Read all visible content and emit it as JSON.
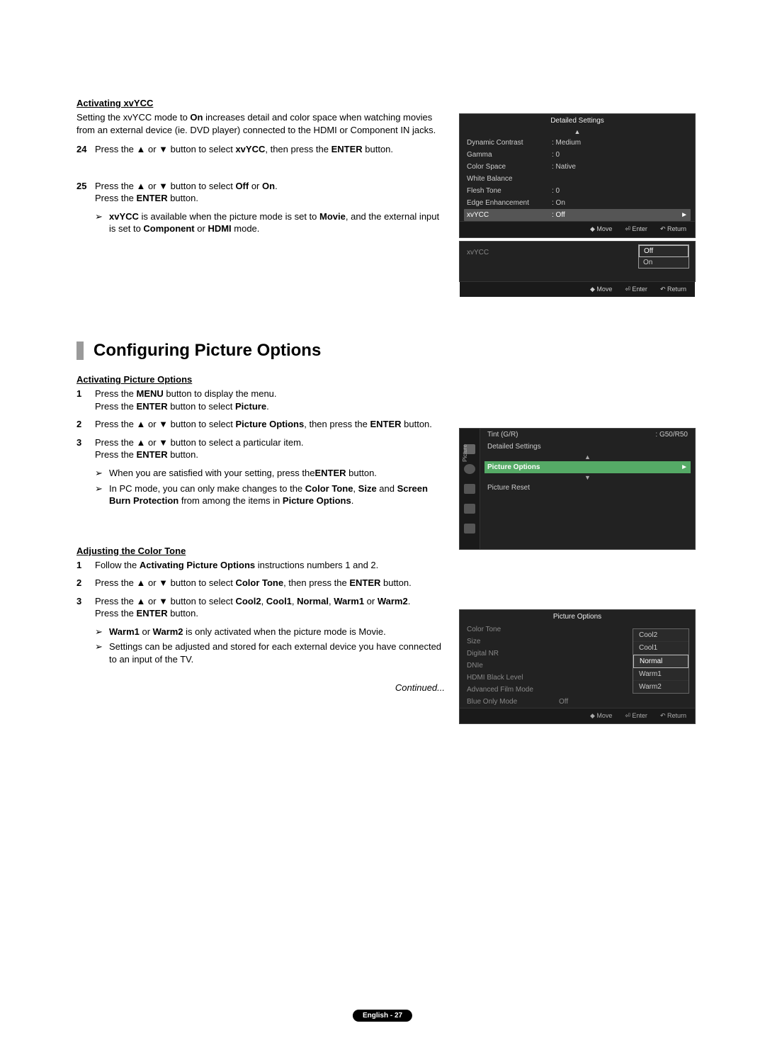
{
  "section_xvycc": {
    "heading": "Activating xvYCC",
    "intro_html": "Setting the xvYCC mode to <b>On</b> increases detail and color space when watching movies from an external device (ie. DVD player) connected to the HDMI or Component IN jacks.",
    "step24_num": "24",
    "step24_html": "Press the ▲ or ▼ button to select <b>xvYCC</b>, then press the <b>ENTER</b> button.",
    "step25_num": "25",
    "step25_line1_html": "Press the ▲ or ▼ button to select <b>Off</b> or <b>On</b>.",
    "step25_line2_html": "Press the <b>ENTER</b> button.",
    "note_html": "<b>xvYCC</b> is available when the picture mode is set to <b>Movie</b>, and the external input is set to <b>Component</b> or <b>HDMI</b> mode."
  },
  "section_title": "Configuring Picture Options",
  "section_po": {
    "heading": "Activating Picture Options",
    "step1_num": "1",
    "step1_line1_html": "Press the <b>MENU</b> button to display the menu.",
    "step1_line2_html": "Press the <b>ENTER</b> button to select <b>Picture</b>.",
    "step2_num": "2",
    "step2_html": "Press the ▲ or ▼ button to select <b>Picture Options</b>, then press the <b>ENTER</b> button.",
    "step3_num": "3",
    "step3_line1_html": "Press the ▲ or ▼ button to select a particular item.",
    "step3_line2_html": "Press the <b>ENTER</b> button.",
    "note1_html": "When you are satisfied with your setting, press the<b>ENTER</b> button.",
    "note2_html": "In PC mode, you can only make changes to the <b>Color Tone</b>, <b>Size</b> and <b>Screen Burn Protection</b> from among the items in <b>Picture Options</b>."
  },
  "section_ct": {
    "heading": "Adjusting the Color Tone",
    "step1_num": "1",
    "step1_html": "Follow the <b>Activating Picture Options</b> instructions numbers 1 and 2.",
    "step2_num": "2",
    "step2_html": "Press the ▲ or ▼ button to select <b>Color Tone</b>, then press the <b>ENTER</b> button.",
    "step3_num": "3",
    "step3_line1_html": "Press the ▲ or ▼ button to select <b>Cool2</b>, <b>Cool1</b>, <b>Normal</b>, <b>Warm1</b> or <b>Warm2</b>.",
    "step3_line2_html": "Press the <b>ENTER</b> button.",
    "note1_html": "<b>Warm1</b> or <b>Warm2</b> is only activated when the picture mode is Movie.",
    "note2_html": "Settings can be adjusted and stored for each external device you have connected to an input of the TV."
  },
  "continued": "Continued...",
  "page_label": "English - 27",
  "arrow_glyph": "➢",
  "osd_detailed": {
    "title": "Detailed Settings",
    "rows": [
      {
        "label": "Dynamic Contrast",
        "val": ": Medium"
      },
      {
        "label": "Gamma",
        "val": ": 0"
      },
      {
        "label": "Color Space",
        "val": ": Native"
      },
      {
        "label": "White Balance",
        "val": ""
      },
      {
        "label": "Flesh Tone",
        "val": ": 0"
      },
      {
        "label": "Edge Enhancement",
        "val": ": On"
      }
    ],
    "sel": {
      "label": "xvYCC",
      "val": ": Off",
      "arrow": "►"
    },
    "footer": {
      "move": "◆ Move",
      "enter": "⏎ Enter",
      "return": "↶ Return"
    }
  },
  "osd_xvycc": {
    "label": "xvYCC",
    "options": [
      "Off",
      "On"
    ],
    "selected": "Off",
    "footer": {
      "move": "◆ Move",
      "enter": "⏎ Enter",
      "return": "↶ Return"
    }
  },
  "osd_picture": {
    "side_label": "Picture",
    "rows_top": [
      {
        "label": "Tint (G/R)",
        "val": ": G50/R50"
      },
      {
        "label": "Detailed Settings",
        "val": ""
      }
    ],
    "sel": {
      "label": "Picture Options",
      "arrow": "►"
    },
    "rows_bot": [
      {
        "label": "Picture Reset",
        "val": ""
      }
    ]
  },
  "osd_pictureoptions": {
    "title": "Picture Options",
    "rows": [
      {
        "label": "Color Tone",
        "val": ""
      },
      {
        "label": "Size",
        "val": ""
      },
      {
        "label": "Digital NR",
        "val": ""
      },
      {
        "label": "DNIe",
        "val": ""
      },
      {
        "label": "HDMI Black Level",
        "val": ""
      },
      {
        "label": "Advanced Film Mode",
        "val": ""
      },
      {
        "label": "Blue Only Mode",
        "val": "Off"
      }
    ],
    "options": [
      "Cool2",
      "Cool1",
      "Normal",
      "Warm1",
      "Warm2"
    ],
    "selected": "Normal",
    "footer": {
      "move": "◆ Move",
      "enter": "⏎ Enter",
      "return": "↶ Return"
    }
  }
}
